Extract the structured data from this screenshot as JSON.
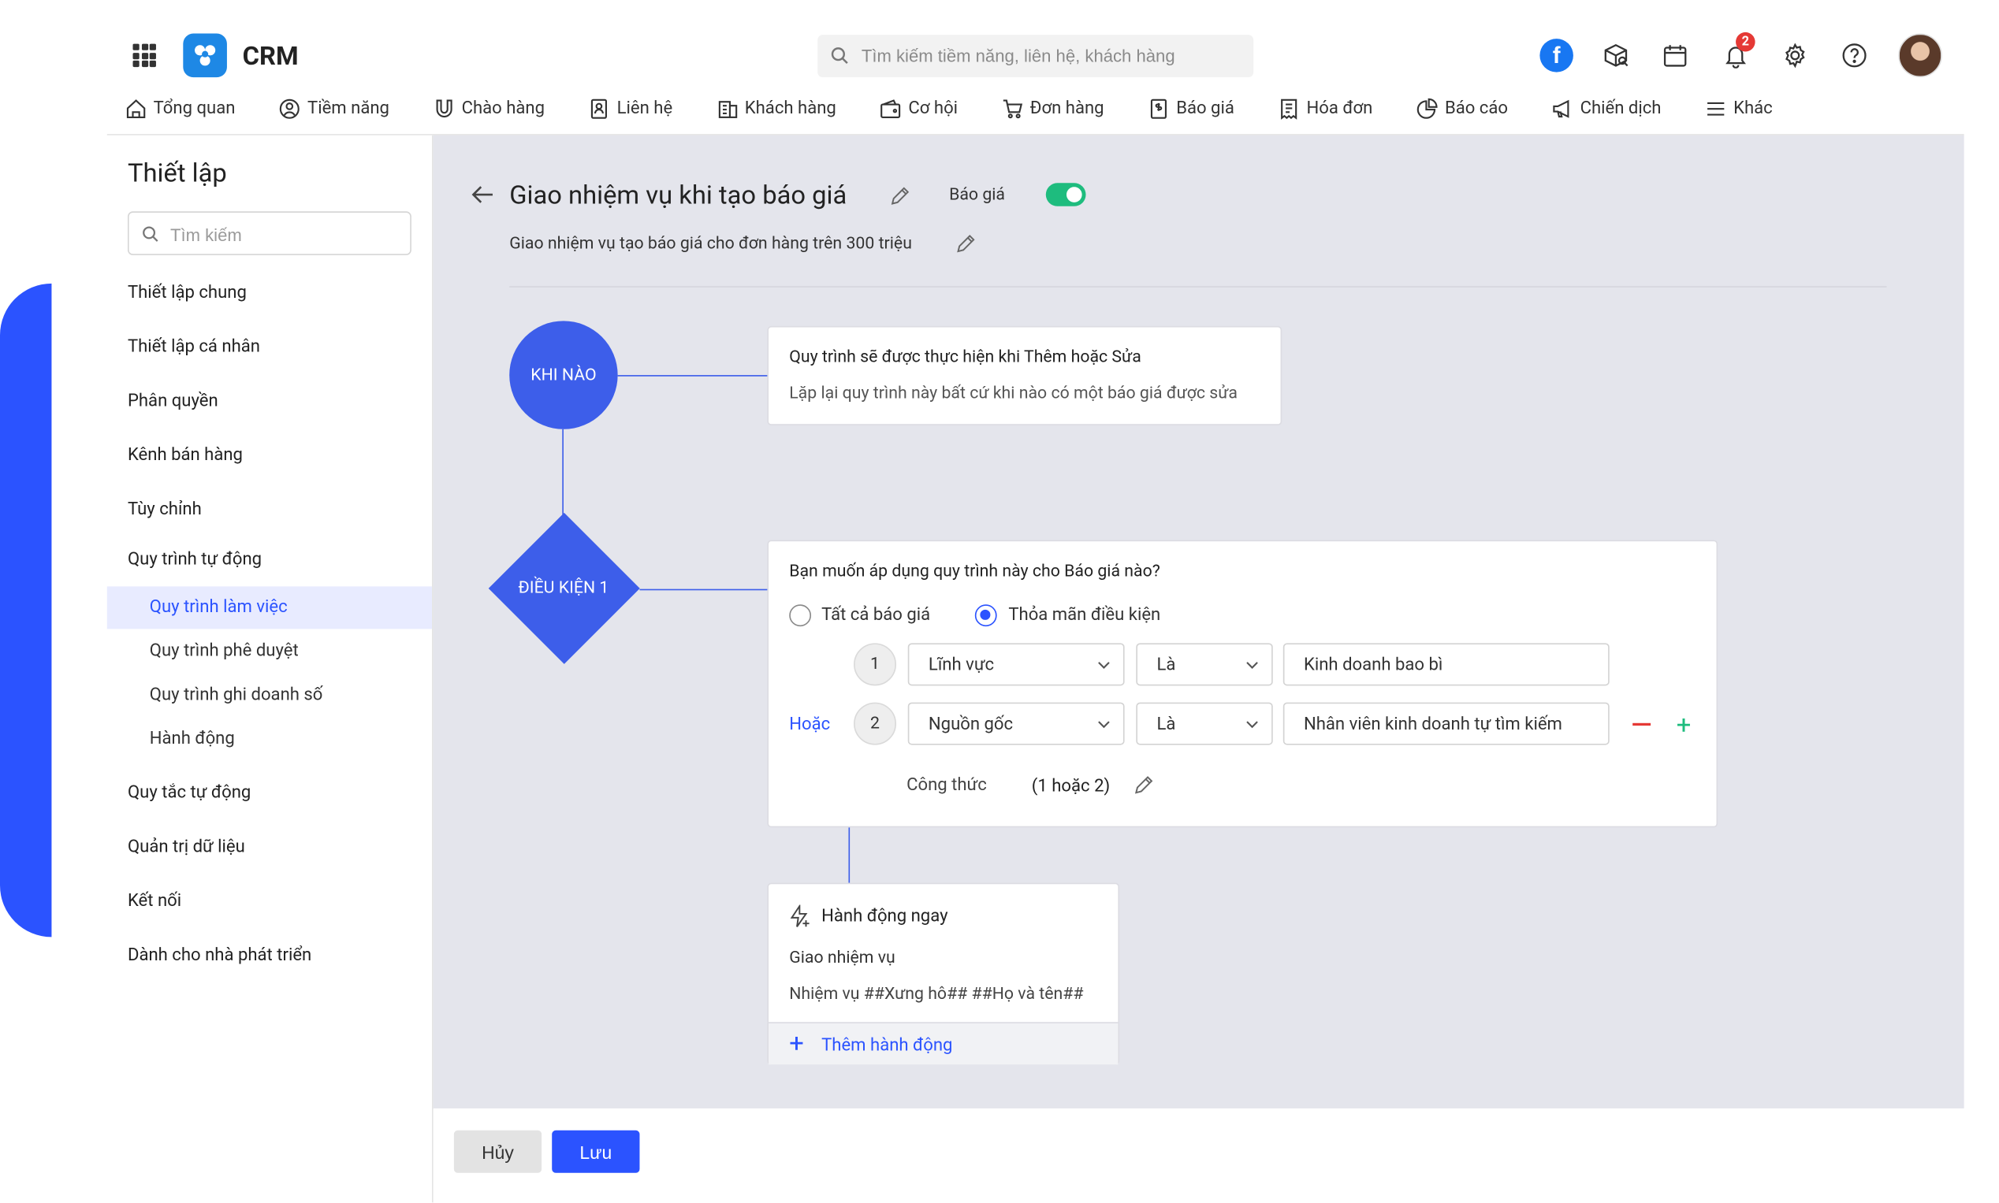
{
  "header": {
    "app_name": "CRM",
    "search_placeholder": "Tìm kiếm tiềm năng, liên hệ, khách hàng",
    "notification_count": "2",
    "facebook_letter": "f"
  },
  "nav": [
    {
      "label": "Tổng quan",
      "icon": "home-icon"
    },
    {
      "label": "Tiềm năng",
      "icon": "target-icon"
    },
    {
      "label": "Chào hàng",
      "icon": "magnet-icon"
    },
    {
      "label": "Liên hệ",
      "icon": "contact-icon"
    },
    {
      "label": "Khách hàng",
      "icon": "building-icon"
    },
    {
      "label": "Cơ hội",
      "icon": "wallet-icon"
    },
    {
      "label": "Đơn hàng",
      "icon": "cart-icon"
    },
    {
      "label": "Báo giá",
      "icon": "quote-icon"
    },
    {
      "label": "Hóa đơn",
      "icon": "invoice-icon"
    },
    {
      "label": "Báo cáo",
      "icon": "pie-chart-icon"
    },
    {
      "label": "Chiến dịch",
      "icon": "megaphone-icon"
    },
    {
      "label": "Khác",
      "icon": "menu-icon"
    }
  ],
  "sidebar": {
    "title": "Thiết lập",
    "search_placeholder": "Tìm kiếm",
    "items": [
      "Thiết lập chung",
      "Thiết lập cá nhân",
      "Phân quyền",
      "Kênh bán hàng",
      "Tùy chỉnh",
      "Quy trình tự động"
    ],
    "sub_items": [
      "Quy trình làm việc",
      "Quy trình phê duyệt",
      "Quy trình ghi doanh số",
      "Hành động"
    ],
    "items_after": [
      "Quy tắc tự động",
      "Quản trị dữ liệu",
      "Kết nối",
      "Dành cho nhà phát triển"
    ]
  },
  "workflow": {
    "title": "Giao nhiệm vụ khi tạo báo giá",
    "object_label": "Báo giá",
    "enabled": true,
    "description": "Giao nhiệm vụ tạo báo giá cho đơn hàng trên 300 triệu",
    "when_node": "KHI NÀO",
    "when_title": "Quy trình sẽ được thực hiện khi Thêm hoặc Sửa",
    "when_sub": "Lặp lại quy trình này bất cứ khi nào có một báo giá được sửa",
    "condition_node": "ĐIỀU KIỆN 1",
    "condition_question": "Bạn muốn áp dụng quy trình này cho Báo giá nào?",
    "radio_all": "Tất cả báo giá",
    "radio_match": "Thỏa mãn điều kiện",
    "rows": [
      {
        "num": "1",
        "field": "Lĩnh vực",
        "op": "Là",
        "value": "Kinh doanh bao bì"
      },
      {
        "num": "2",
        "field": "Nguồn gốc",
        "op": "Là",
        "value": "Nhân viên kinh doanh tự tìm kiếm"
      }
    ],
    "or_label": "Hoặc",
    "formula_label": "Công thức",
    "formula_value": "(1 hoặc 2)",
    "action_header": "Hành động ngay",
    "action_name": "Giao nhiệm vụ",
    "action_detail": "Nhiệm vụ ##Xưng hô## ##Họ và tên##",
    "add_action": "Thêm hành động"
  },
  "footer": {
    "cancel": "Hủy",
    "save": "Lưu"
  },
  "colors": {
    "accent": "#2b53ff",
    "node": "#3d5eea",
    "toggle_on": "#1ebc7e",
    "danger": "#e53935"
  }
}
